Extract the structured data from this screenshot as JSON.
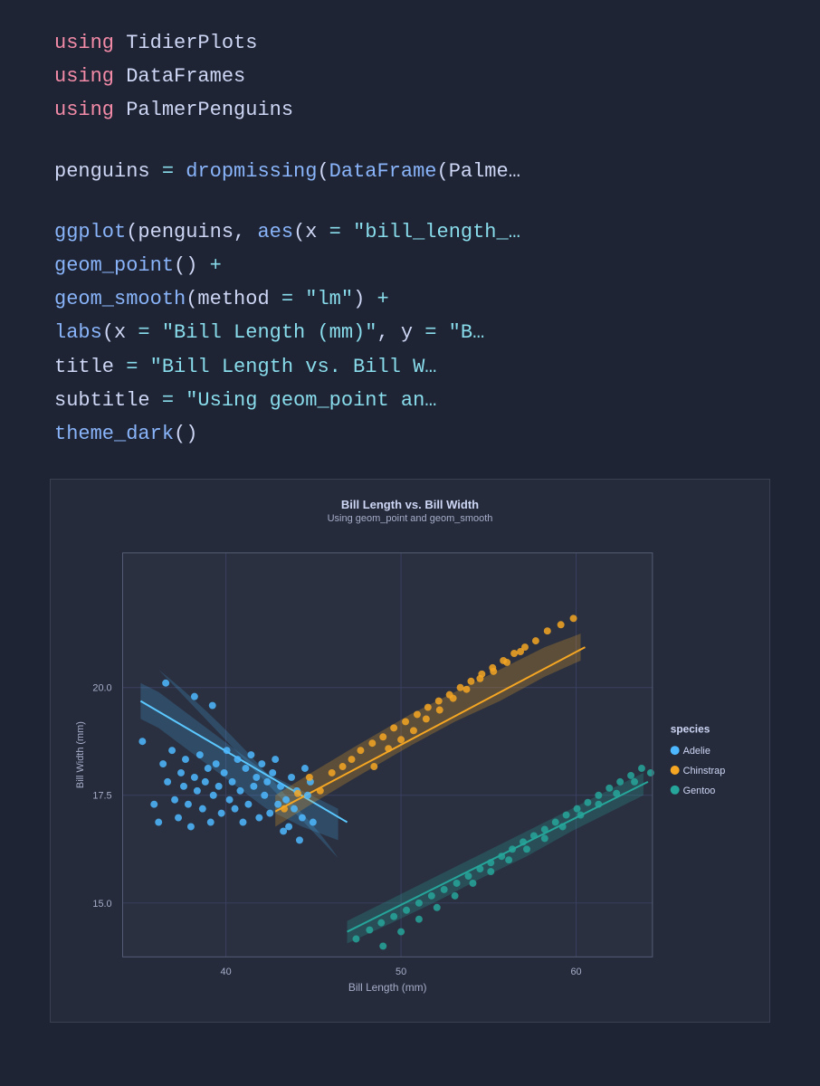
{
  "background": "#1e2433",
  "code": {
    "lines": [
      {
        "type": "keyword_module",
        "keyword": "using",
        "module": " TidierPlots"
      },
      {
        "type": "keyword_module",
        "keyword": "using",
        "module": " DataFrames"
      },
      {
        "type": "keyword_module",
        "keyword": "using",
        "module": " PalmerPenguins"
      },
      {
        "type": "empty"
      },
      {
        "type": "assignment",
        "text": "penguins = dropmissing(DataFrame(Palme…"
      },
      {
        "type": "empty"
      },
      {
        "type": "code",
        "text": "ggplot(penguins, aes(x = \"bill_length_…"
      },
      {
        "type": "code_indent",
        "text": "    geom_point() +"
      },
      {
        "type": "code_indent",
        "text": "    geom_smooth(method = \"lm\") +"
      },
      {
        "type": "code_indent",
        "text": "    labs(x = \"Bill Length (mm)\", y = \"B…"
      },
      {
        "type": "code_indent2",
        "text": "        title = \"Bill Length vs. Bill W…"
      },
      {
        "type": "code_indent2",
        "text": "        subtitle = \"Using geom_point an…"
      },
      {
        "type": "code_indent",
        "text": "    theme_dark()"
      }
    ]
  },
  "chart": {
    "title": "Bill Length vs. Bill Width",
    "subtitle": "Using geom_point and geom_smooth",
    "xaxis": {
      "label": "Bill Length (mm)",
      "ticks": [
        "40",
        "50",
        "60"
      ]
    },
    "yaxis": {
      "label": "Bill Width (mm)",
      "ticks": [
        "15.0",
        "17.5",
        "20.0"
      ]
    },
    "legend": {
      "title": "species",
      "items": [
        {
          "label": "Adelie",
          "color": "#4db8ff"
        },
        {
          "label": "Chinstrap",
          "color": "#f5a623"
        },
        {
          "label": "Gentoo",
          "color": "#26a69a"
        }
      ]
    }
  }
}
